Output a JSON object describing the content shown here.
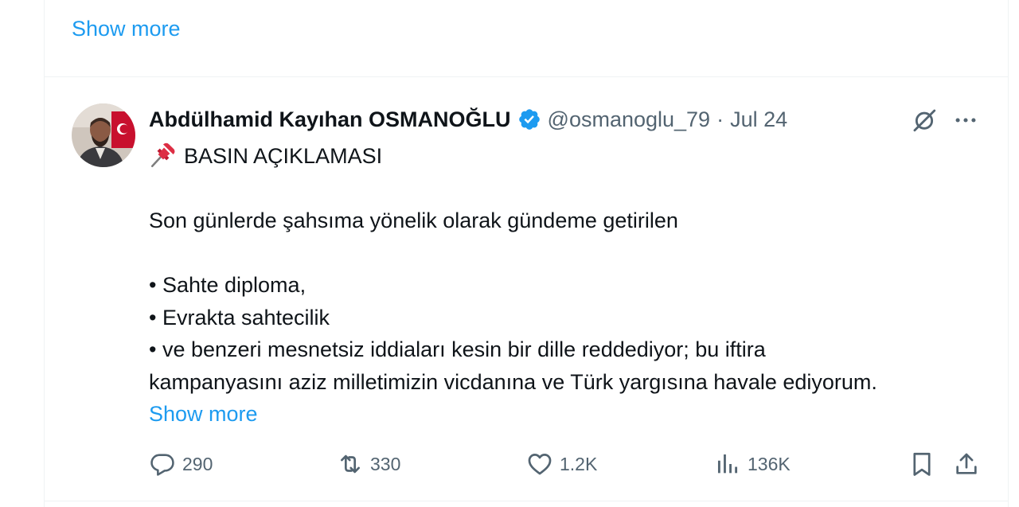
{
  "top_tweet": {
    "show_more_label": "Show more"
  },
  "tweet": {
    "author": {
      "display_name": "Abdülhamid Kayıhan OSMANOĞLU",
      "handle": "@osmanoglu_79",
      "separator": "·",
      "date": "Jul 24",
      "verified": true
    },
    "body": {
      "title": "BASIN AÇIKLAMASI",
      "pin_icon": "pushpin-emoji",
      "paragraph_1": "Son günlerde şahsıma yönelik olarak gündeme getirilen",
      "bullet_1": "• Sahte diploma,",
      "bullet_2": "• Evrakta sahtecilik",
      "bullet_3_line_1": "• ve benzeri mesnetsiz iddiaları kesin bir dille reddediyor; bu iftira",
      "bullet_3_line_2": "kampanyasını aziz milletimizin vicdanına ve Türk yargısına havale ediyorum.",
      "show_more_label": "Show more"
    },
    "actions": {
      "replies": "290",
      "reposts": "330",
      "likes": "1.2K",
      "views": "136K"
    }
  },
  "colors": {
    "accent": "#1d9bf0",
    "text_primary": "#0f1419",
    "text_secondary": "#536471",
    "border": "#eff3f4",
    "pin_red": "#dd2e44"
  }
}
